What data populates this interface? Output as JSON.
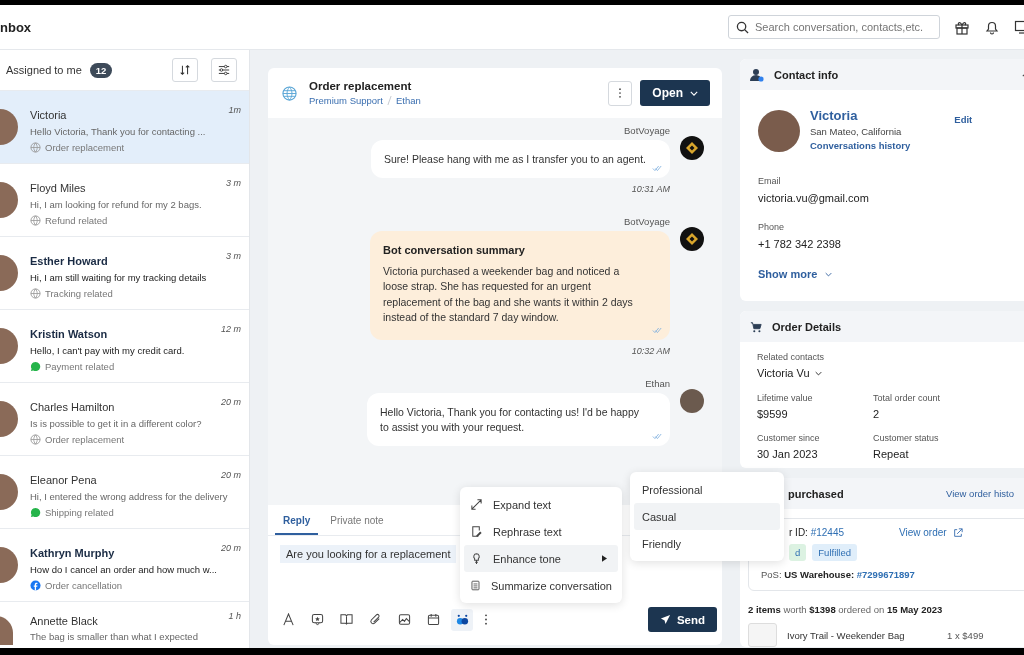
{
  "header": {
    "title": "nbox",
    "search": {
      "placeholder": "Search conversation, contacts,etc."
    }
  },
  "conversation_list": {
    "title": "Assigned to me",
    "count": "12",
    "items": [
      {
        "name": "Victoria",
        "preview": "Hello Victoria, Thank you for contacting ...",
        "tag": "Order replacement",
        "kind": "web",
        "time": "1m",
        "unread": false,
        "selected": true
      },
      {
        "name": "Floyd Miles",
        "preview": "Hi, I am looking for refund for my 2 bags.",
        "tag": "Refund related",
        "kind": "web",
        "time": "3 m",
        "unread": false,
        "selected": false
      },
      {
        "name": "Esther Howard",
        "preview": "Hi, I am still waiting for my tracking details",
        "tag": "Tracking related",
        "kind": "web",
        "time": "3 m",
        "unread": true,
        "selected": false
      },
      {
        "name": "Kristin Watson",
        "preview": "Hello, I can't pay with my credit card.",
        "tag": "Payment related",
        "kind": "whatsapp",
        "time": "12 m",
        "unread": true,
        "selected": false
      },
      {
        "name": "Charles Hamilton",
        "preview": "Is is possible to get it in a different color?",
        "tag": "Order replacement",
        "kind": "web",
        "time": "20 m",
        "unread": false,
        "selected": false
      },
      {
        "name": "Eleanor Pena",
        "preview": "Hi, I entered the wrong address for the delivery",
        "tag": "Shipping related",
        "kind": "whatsapp",
        "time": "20 m",
        "unread": false,
        "selected": false
      },
      {
        "name": "Kathryn Murphy",
        "preview": "How do I cancel an order and how much w...",
        "tag": "Order cancellation",
        "kind": "facebook",
        "time": "20 m",
        "unread": true,
        "selected": false
      },
      {
        "name": "Annette Black",
        "preview": "The bag is smaller than what I expected",
        "time": "1 h",
        "unread": false,
        "selected": false
      }
    ]
  },
  "conversation": {
    "title": "Order replacement",
    "team": "Premium Support",
    "agent": "Ethan",
    "status": "Open",
    "messages": [
      {
        "kind": "bot",
        "sender": "BotVoyage",
        "text": "Sure! Please hang with me as I transfer you to an agent.",
        "time": "10:31 AM"
      },
      {
        "kind": "summary",
        "sender": "BotVoyage",
        "title": "Bot conversation summary",
        "text": "Victoria purchased a weekender bag and noticed a loose strap. She has requested for an urgent replacement of the bag and she wants it within 2 days instead of the standard 7 day window.",
        "time": "10:32 AM"
      },
      {
        "kind": "agent",
        "sender": "Ethan",
        "text": "Hello Victoria, Thank you for contacting us! I'd be happy to assist you with your request."
      }
    ]
  },
  "composer": {
    "tabs": [
      {
        "label": "Reply",
        "selected": true
      },
      {
        "label": "Private note",
        "selected": false
      }
    ],
    "value": "Are you looking for a replacement",
    "send": "Send"
  },
  "ai_menu": {
    "items": [
      {
        "label": "Expand text",
        "active": false,
        "submenu": false
      },
      {
        "label": "Rephrase text",
        "active": false,
        "submenu": false
      },
      {
        "label": "Enhance tone",
        "active": true,
        "submenu": true
      },
      {
        "label": "Summarize conversation",
        "active": false,
        "submenu": false
      }
    ]
  },
  "tone_menu": {
    "items": [
      {
        "label": "Professional",
        "active": false
      },
      {
        "label": "Casual",
        "active": true
      },
      {
        "label": "Friendly",
        "active": false
      }
    ]
  },
  "contact": {
    "title": "Contact info",
    "name": "Victoria",
    "location": "San Mateo, California",
    "history_link": "Conversations history",
    "edit": "Edit",
    "fields": [
      {
        "label": "Email",
        "value": "victoria.vu@gmail.com"
      },
      {
        "label": "Phone",
        "value": "+1 782 342 2398"
      }
    ],
    "show_more": "Show more"
  },
  "order_details": {
    "title": "Order Details",
    "related_label": "Related contacts",
    "related_value": "Victoria Vu",
    "stats": [
      {
        "label": "Lifetime value",
        "value": "$9599"
      },
      {
        "label": "Total order count",
        "value": "2"
      },
      {
        "label": "Customer since",
        "value": "30 Jan 2023"
      },
      {
        "label": "Customer status",
        "value": "Repeat"
      }
    ]
  },
  "purchased": {
    "title": "purchased",
    "history_link": "View order histo",
    "order_label": "r ID:",
    "order_id": "#12445",
    "view_order": "View order",
    "tags": [
      {
        "label": "d",
        "color": "#dcf2e2"
      },
      {
        "label": "Fulfilled",
        "color": "#e0eefa"
      }
    ],
    "pos_label": "PoS:",
    "pos_store": "US Warehouse:",
    "pos_id": "#7299671897",
    "summary": "**2 items** worth **$1398** ordered on **15 May 2023**",
    "items": [
      {
        "name": "Ivory Trail - Weekender Bag",
        "qty": "1 x $499"
      }
    ]
  }
}
